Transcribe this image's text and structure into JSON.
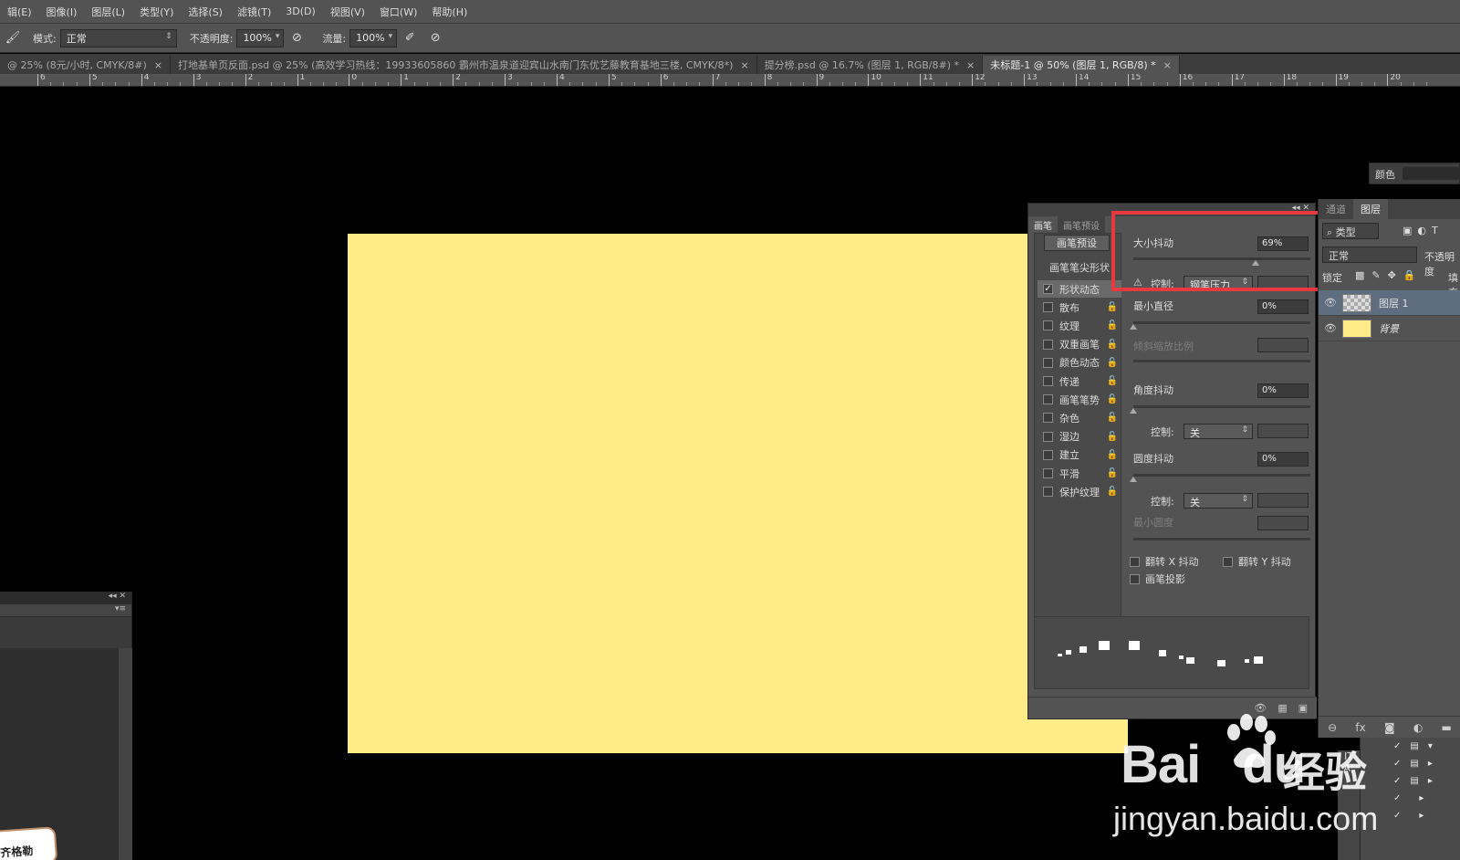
{
  "menu": [
    "辑(E)",
    "图像(I)",
    "图层(L)",
    "类型(Y)",
    "选择(S)",
    "滤镜(T)",
    "3D(D)",
    "视图(V)",
    "窗口(W)",
    "帮助(H)"
  ],
  "options": {
    "mode_label": "模式:",
    "mode_value": "正常",
    "opacity_label": "不透明度:",
    "opacity_value": "100%",
    "flow_label": "流量:",
    "flow_value": "100%"
  },
  "tabs": [
    {
      "label": "@ 25% (8元/小时, CMYK/8#)",
      "close": "×"
    },
    {
      "label": "打地基单页反面.psd @ 25% (高效学习热线：19933605860 霸州市温泉道迎宾山水南门东优艺藤教育基地三楼, CMYK/8*)",
      "close": "×"
    },
    {
      "label": "提分榜.psd @ 16.7% (图层 1, RGB/8#) *",
      "close": "×"
    },
    {
      "label": "未标题-1 @ 50% (图层 1, RGB/8) *",
      "close": "×"
    }
  ],
  "ruler": [
    "6",
    "5",
    "4",
    "3",
    "2",
    "1",
    "0",
    "1",
    "2",
    "3",
    "4",
    "5",
    "6",
    "7",
    "8",
    "9",
    "10",
    "11",
    "12",
    "13",
    "14",
    "15",
    "16",
    "17",
    "18",
    "19",
    "20"
  ],
  "canvas_color": "#ffeb88",
  "brush_panel": {
    "tab_brush": "画笔",
    "tab_presets": "画笔预设",
    "preset_button": "画笔预设",
    "tip_header": "画笔笔尖形状",
    "options": [
      {
        "label": "形状动态",
        "checked": true
      },
      {
        "label": "散布",
        "checked": false
      },
      {
        "label": "纹理",
        "checked": false
      },
      {
        "label": "双重画笔",
        "checked": false
      },
      {
        "label": "颜色动态",
        "checked": false
      },
      {
        "label": "传递",
        "checked": false
      },
      {
        "label": "画笔笔势",
        "checked": false
      },
      {
        "label": "杂色",
        "checked": false
      },
      {
        "label": "湿边",
        "checked": false
      },
      {
        "label": "建立",
        "checked": false
      },
      {
        "label": "平滑",
        "checked": false
      },
      {
        "label": "保护纹理",
        "checked": false
      }
    ],
    "size_jitter_label": "大小抖动",
    "size_jitter_value": "69%",
    "size_jitter_fraction": 0.69,
    "control_label": "控制:",
    "control_value": "钢笔压力",
    "min_diameter_label": "最小直径",
    "min_diameter_value": "0%",
    "tilt_scale_label": "倾斜缩放比例",
    "angle_jitter_label": "角度抖动",
    "angle_jitter_value": "0%",
    "angle_control_label": "控制:",
    "angle_control_value": "关",
    "roundness_jitter_label": "圆度抖动",
    "roundness_jitter_value": "0%",
    "roundness_control_label": "控制:",
    "roundness_control_value": "关",
    "min_roundness_label": "最小圆度",
    "flip_x_label": "翻转 X 抖动",
    "flip_y_label": "翻转 Y 抖动",
    "brush_projection_label": "画笔投影"
  },
  "color_panel": {
    "label": "颜色"
  },
  "layers_panel": {
    "tab_other": "通道",
    "tab_layers": "图层",
    "filter_label": "类型",
    "blend_value": "正常",
    "opacity_label": "不透明度",
    "lock_label": "锁定",
    "fill_label": "填充",
    "layers": [
      {
        "name": "图层 1",
        "selected": true
      },
      {
        "name": "背景",
        "selected": false
      }
    ]
  },
  "watermark": {
    "brand": "Bai",
    "brand2": "du",
    "cn": "经验",
    "url": "jingyan.baidu.com"
  },
  "note_text": "齐格勒"
}
